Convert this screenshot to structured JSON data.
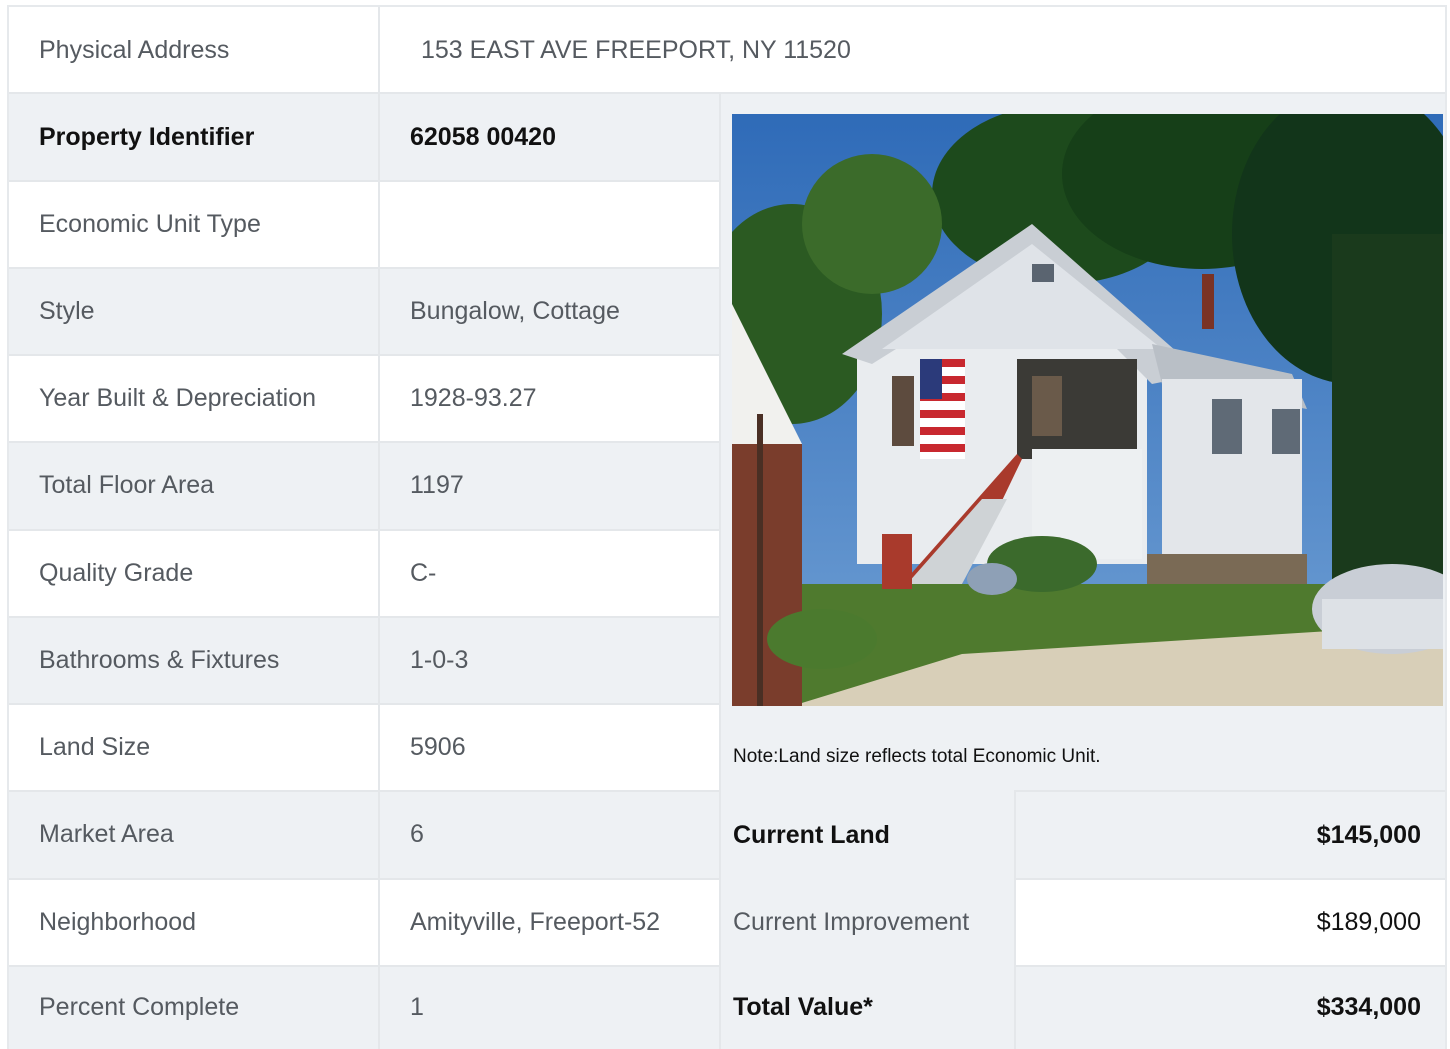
{
  "address": {
    "label": "Physical Address",
    "value": "153  EAST AVE  FREEPORT, NY  11520"
  },
  "rows": [
    {
      "label": "Property Identifier",
      "value": "62058  00420"
    },
    {
      "label": "Economic Unit Type",
      "value": ""
    },
    {
      "label": "Style",
      "value": "Bungalow, Cottage"
    },
    {
      "label": "Year Built & Depreciation",
      "value": "1928-93.27"
    },
    {
      "label": "Total Floor Area",
      "value": "1197"
    },
    {
      "label": "Quality Grade",
      "value": "C-"
    },
    {
      "label": "Bathrooms & Fixtures",
      "value": "1-0-3"
    },
    {
      "label": "Land Size",
      "value": "5906"
    },
    {
      "label": "Market Area",
      "value": "6"
    },
    {
      "label": "Neighborhood",
      "value": "Amityville, Freeport-52"
    },
    {
      "label": "Percent Complete",
      "value": "1"
    }
  ],
  "note": "Note:Land size reflects total Economic Unit.",
  "values": [
    {
      "label": "Current Land",
      "value": "$145,000"
    },
    {
      "label": "Current Improvement",
      "value": "$189,000"
    },
    {
      "label": "Total Value*",
      "value": "$334,000"
    }
  ],
  "colors": {
    "shade": "#eef1f4",
    "border": "#e4e7ea",
    "bold_text": "#111111",
    "text": "#555a60"
  }
}
